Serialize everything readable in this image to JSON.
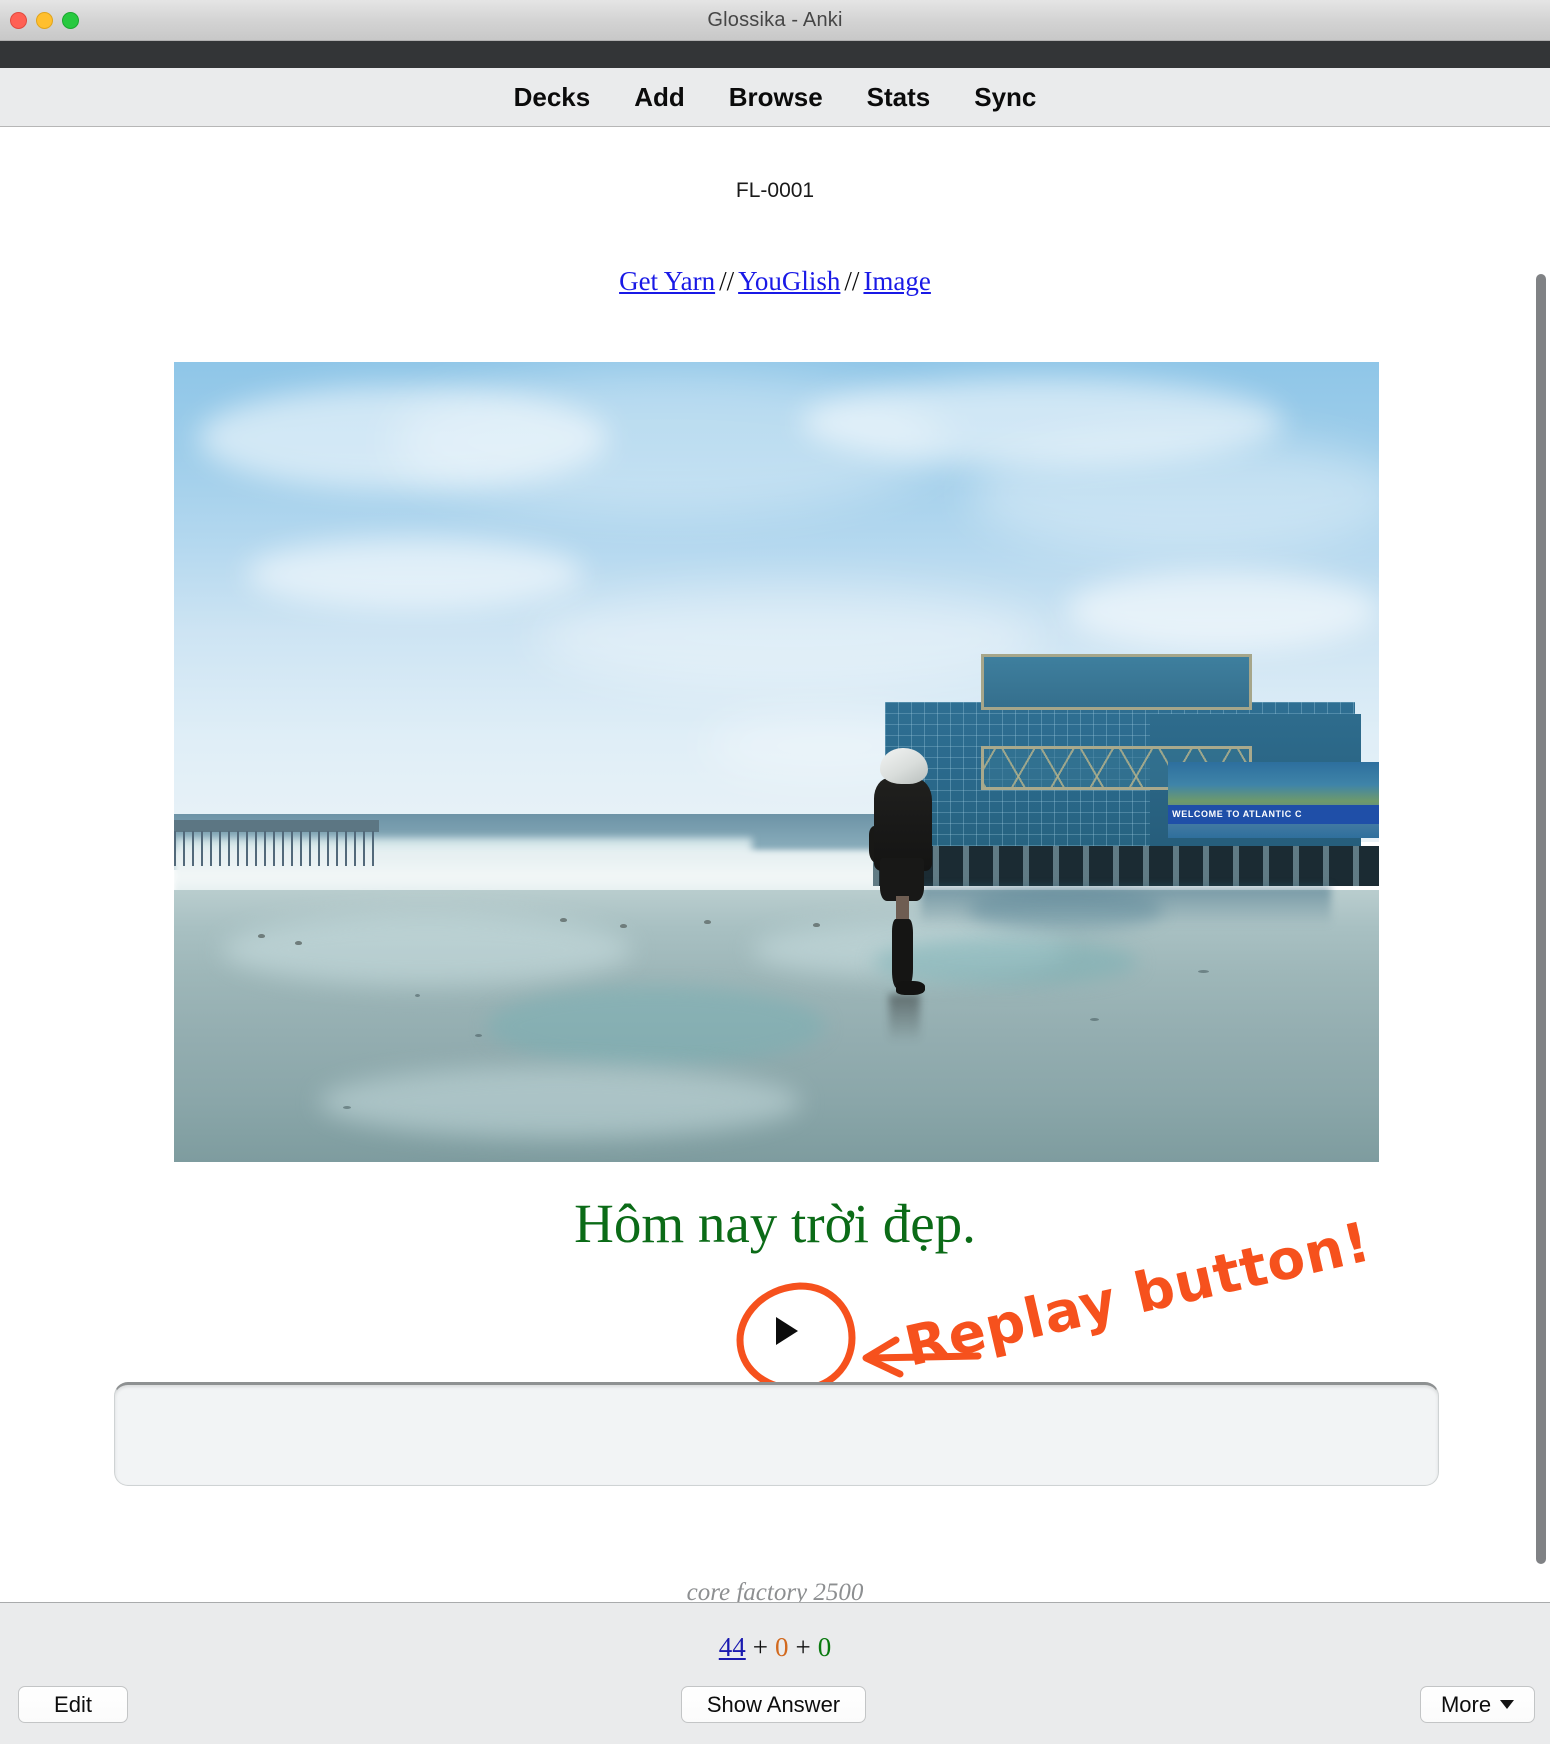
{
  "window": {
    "title": "Glossika - Anki",
    "traffic_lights": [
      "close-button",
      "minimize-button",
      "maximize-button"
    ]
  },
  "nav": {
    "items": [
      {
        "label": "Decks",
        "name": "nav-decks"
      },
      {
        "label": "Add",
        "name": "nav-add"
      },
      {
        "label": "Browse",
        "name": "nav-browse"
      },
      {
        "label": "Stats",
        "name": "nav-stats"
      },
      {
        "label": "Sync",
        "name": "nav-sync"
      }
    ]
  },
  "card": {
    "id_label": "FL-0001",
    "links": [
      {
        "label": "Get Yarn",
        "name": "link-get-yarn"
      },
      {
        "label": "YouGlish",
        "name": "link-youglish"
      },
      {
        "label": "Image",
        "name": "link-image"
      }
    ],
    "link_separator": "//",
    "sentence": "Hôm nay trời đẹp.",
    "sentence_color": "#0b6b17",
    "type_answer_value": "",
    "type_answer_placeholder": "",
    "cut_off_note": "core factory 2500",
    "image": {
      "alt": "Woman in dark coat walking on a wet beach with a blue glass convention center behind her",
      "billboard_text": "WELCOME TO ATLANTIC C"
    }
  },
  "annotation": {
    "text": "Replay button!",
    "color": "#f6511d",
    "target": "replay-button"
  },
  "replay": {
    "icon": "play-triangle-icon"
  },
  "counts": {
    "new": "44",
    "plus": "+",
    "learning": "0",
    "due": "0",
    "new_color": "#1a1ab0",
    "learning_color": "#d2691e",
    "due_color": "#0b7a10"
  },
  "footer_buttons": {
    "edit": "Edit",
    "show_answer": "Show Answer",
    "more": "More"
  }
}
